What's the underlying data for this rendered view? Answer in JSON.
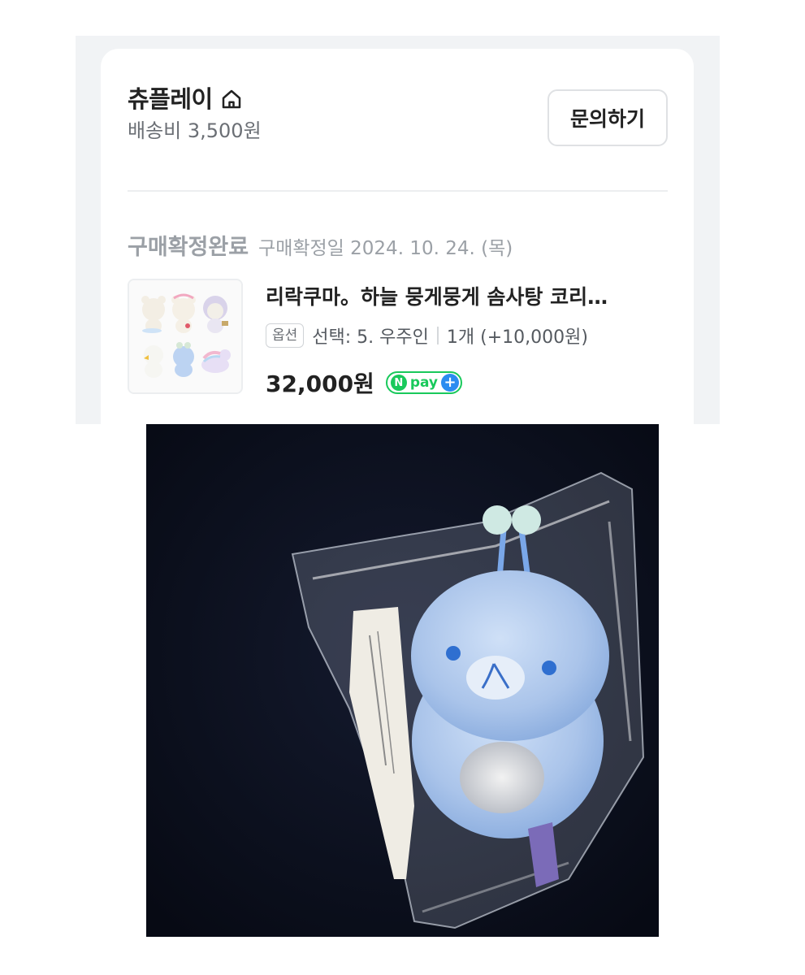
{
  "seller": {
    "name": "츄플레이",
    "shipping": "배송비 3,500원",
    "inquiry_label": "문의하기"
  },
  "order": {
    "status": "구매확정완료",
    "confirm_date": "구매확정일 2024. 10. 24. (목)"
  },
  "product": {
    "title": "리락쿠마。하늘 뭉게뭉게 솜사탕 코리…",
    "option_badge": "옵션",
    "option_value": "선택: 5. 우주인",
    "quantity": "1개 (+10,000원)",
    "price": "32,000원",
    "pay_badge": {
      "mark": "N",
      "label": "pay",
      "plus": "+"
    }
  },
  "icons": {
    "seller_home": "home-icon",
    "pay": "npay-plus-icon"
  },
  "colors": {
    "npay_green": "#19c95b",
    "npay_plus_blue": "#2b8cf0",
    "status_gray": "#9ba0a6"
  }
}
